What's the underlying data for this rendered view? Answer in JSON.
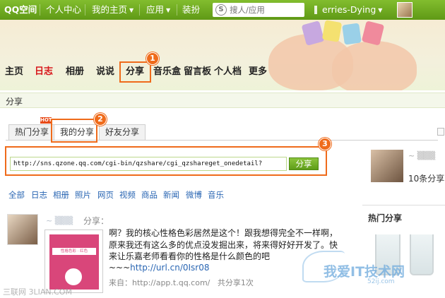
{
  "topbar": {
    "logo": "QQ空间",
    "items": [
      "个人中心",
      "我的主页",
      "应用",
      "装扮"
    ],
    "search_placeholder": "搜人/应用",
    "search_icon_glyph": "S",
    "username": "erries-Dying",
    "accent_color": "#6da81d"
  },
  "nav": {
    "items": [
      "主页",
      "日志",
      "相册",
      "说说",
      "分享",
      "音乐盒",
      "留言板",
      "个人档",
      "更多"
    ],
    "active_index": 1,
    "highlighted_index": 4
  },
  "markers": [
    "1",
    "2",
    "3"
  ],
  "section": {
    "title": "分享"
  },
  "tabs": {
    "items": [
      "热门分享",
      "我的分享",
      "好友分享"
    ],
    "hot_badge": "HOT",
    "active_index": 1
  },
  "share_box": {
    "url_value": "http://sns.qzone.qq.com/cgi-bin/qzshare/cgi_qzshareget_onedetail?",
    "button_label": "分享"
  },
  "filters": [
    "全部",
    "日志",
    "相册",
    "照片",
    "网页",
    "视频",
    "商品",
    "新闻",
    "微博",
    "音乐"
  ],
  "sidebar": {
    "share_count": "10条分享",
    "hot_title": "热门分享"
  },
  "feed": {
    "action": "分享：",
    "thumbnail_band": "性格色彩 · 红色",
    "post_text": "啊？我的核心性格色彩居然是这个！跟我想得完全不一样啊，原来我还有这么多的优点没发掘出来，将来得好好开发了。快来让乐嘉老师看看你的性格是什么颜色的吧",
    "link_prefix": "~~~",
    "link": "http://url.cn/0Isr08",
    "source": "来自：http://app.t.qq.com/",
    "share_total": "共分享1次"
  },
  "watermarks": {
    "left": "三联网 3LIAN.COM",
    "right": "我爱IT技术网",
    "right_sub": "52ij.com"
  }
}
